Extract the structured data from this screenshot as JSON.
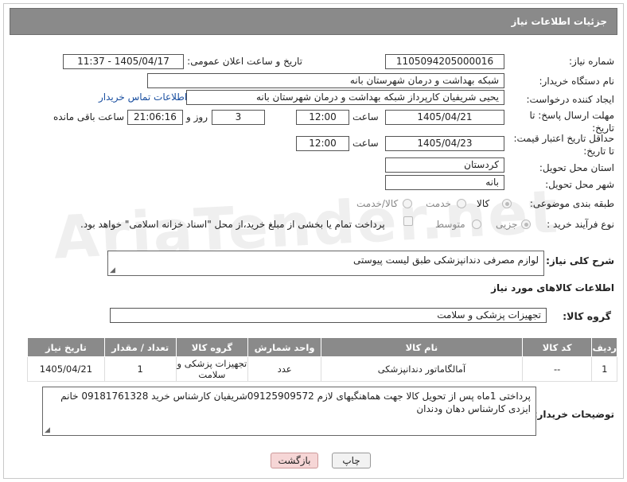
{
  "header": {
    "title": "جزئیات اطلاعات نیاز"
  },
  "fields": {
    "need_number_label": "شماره نیاز:",
    "need_number": "1105094205000016",
    "announce_label": "تاریخ و ساعت اعلان عمومی:",
    "announce_value": "1405/04/17 - 11:37",
    "buyer_org_label": "نام دستگاه خریدار:",
    "buyer_org": "شبکه بهداشت و درمان شهرستان بانه",
    "requester_label": "ایجاد کننده درخواست:",
    "requester": "یحیی شریفیان کارپرداز شبکه بهداشت و درمان شهرستان بانه",
    "contact_link": "اطلاعات تماس خریدار",
    "deadline_label": "مهلت ارسال پاسخ: تا تاریخ:",
    "deadline_date": "1405/04/21",
    "time_label": "ساعت",
    "deadline_time": "12:00",
    "days_value": "3",
    "days_label": "روز و",
    "remaining_time": "21:06:16",
    "remaining_label": "ساعت باقی مانده",
    "validity_label": "حداقل تاریخ اعتبار قیمت: تا تاریخ:",
    "validity_date": "1405/04/23",
    "validity_time": "12:00",
    "province_label": "استان محل تحویل:",
    "province": "کردستان",
    "city_label": "شهر محل تحویل:",
    "city": "بانه",
    "category_label": "طبقه بندی موضوعی:",
    "category_options": [
      "کالا",
      "خدمت",
      "کالا/خدمت"
    ],
    "process_label": "نوع فرآیند خرید :",
    "process_options": [
      "جزیی",
      "متوسط"
    ],
    "payment_note": "پرداخت تمام یا بخشی از مبلغ خرید،از محل \"اسناد خزانه اسلامی\" خواهد بود.",
    "description_label": "شرح کلی نیاز:",
    "description": "لوازم مصرفی دندانپزشکی طبق لیست پیوستی",
    "goods_info_label": "اطلاعات کالاهای مورد نیاز",
    "goods_group_label": "گروه کالا:",
    "goods_group": "تجهیزات پزشکی و سلامت",
    "buyer_notes_label": "توضیحات خریدار:",
    "buyer_notes": "پرداختی 1ماه پس از تحویل کالا جهت هماهنگیهای لازم 09125909572شریفیان کارشناس خرید 09181761328 خانم ایزدی کارشناس دهان ودندان"
  },
  "table": {
    "headers": [
      "ردیف",
      "کد کالا",
      "نام کالا",
      "واحد شمارش",
      "گروه کالا",
      "تعداد / مقدار",
      "تاریخ نیاز"
    ],
    "rows": [
      [
        "1",
        "--",
        "آمالگاماتور دندانپزشکی",
        "عدد",
        "تجهیزات پزشکی و سلامت",
        "1",
        "1405/04/21"
      ]
    ]
  },
  "buttons": {
    "print": "چاپ",
    "back": "بازگشت"
  },
  "watermark": "AriaTender.net",
  "colors": {
    "header_bg": "#8a8a8a",
    "link": "#1a4fa0",
    "back_button": "#f6d6d6"
  }
}
